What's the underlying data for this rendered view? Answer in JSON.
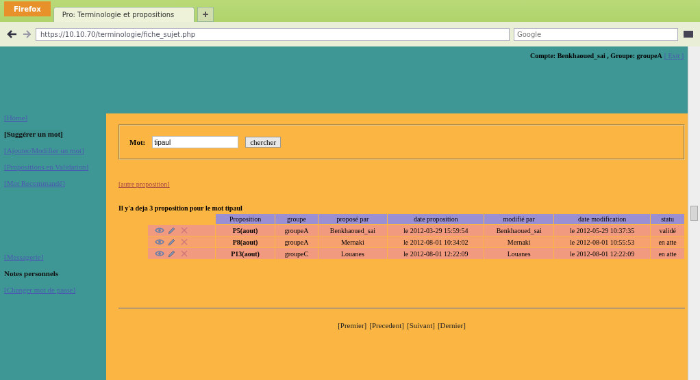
{
  "browser": {
    "menu_button": "Firefox",
    "tab_title": "Pro: Terminologie et propositions",
    "address": "https://10.10.70/terminologie/fiche_sujet.php",
    "search_placeholder": "Google"
  },
  "header": {
    "account": "Compte: Benkhaoued_sai , Groupe: groupeA",
    "logout": "[ Exit ]"
  },
  "sidebar": {
    "items": [
      {
        "label": "[Home]",
        "kind": "link",
        "selected": false
      },
      {
        "label": "[Suggérer un mot]",
        "kind": "link",
        "selected": true
      },
      {
        "label": "[Ajouter/Modifier un mot]",
        "kind": "link",
        "selected": false
      },
      {
        "label": "[Propositions en Validation]",
        "kind": "link",
        "selected": false
      },
      {
        "label": "[Mot Recommandé]",
        "kind": "link",
        "selected": false
      }
    ]
  },
  "sidebar_bottom": {
    "items": [
      {
        "label": "[Messagerie]",
        "kind": "link",
        "selected": false
      },
      {
        "label": "Notes personnels",
        "kind": "heading"
      },
      {
        "label": "[Changer mot de passe]",
        "kind": "link",
        "selected": false
      }
    ]
  },
  "search": {
    "label": "Mot:",
    "value": "tipaul",
    "button": "chercher"
  },
  "other_link": "[autre proposition]",
  "summary": "Il y'a deja 3 proposition pour le mot tipaul",
  "table": {
    "columns": [
      "Proposition",
      "groupe",
      "proposé par",
      "date proposition",
      "modifié par",
      "date modification",
      "statu"
    ],
    "rows": [
      {
        "cells": [
          "P5(aout)",
          "groupeA",
          "Benkhaoued_sai",
          "le 2012-03-29 15:59:54",
          "Benkhaoued_sai",
          "le 2012-05-29 10:37:35",
          "validé"
        ]
      },
      {
        "cells": [
          "P8(aout)",
          "groupeA",
          "Mernaki",
          "le 2012-08-01 10:34:02",
          "Mernaki",
          "le 2012-08-01 10:55:53",
          "en atte"
        ]
      },
      {
        "cells": [
          "P13(aout)",
          "groupeC",
          "Louanes",
          "le 2012-08-01 12:22:09",
          "Louanes",
          "le 2012-08-01 12:22:09",
          "en atte"
        ]
      }
    ]
  },
  "pager": [
    "[Premier]",
    "[Precedent]",
    "[Suivant]",
    "[Dernier]"
  ]
}
